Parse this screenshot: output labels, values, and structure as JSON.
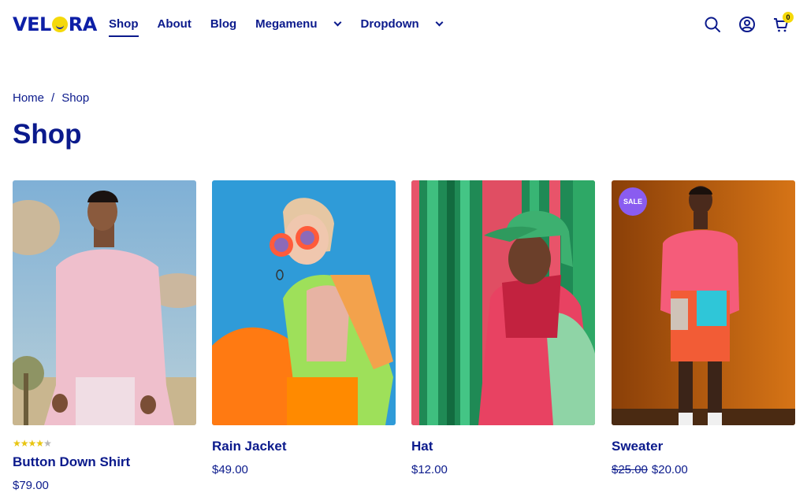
{
  "header": {
    "logo": "VELORA",
    "nav": [
      {
        "label": "Shop",
        "active": true
      },
      {
        "label": "About"
      },
      {
        "label": "Blog"
      },
      {
        "label": "Megamenu"
      },
      {
        "label": "Dropdown"
      }
    ],
    "icons": [
      "search-icon",
      "account-icon",
      "cart-icon"
    ],
    "cart_count": "0"
  },
  "breadcrumb": {
    "home": "Home",
    "separator": "/",
    "current": "Shop"
  },
  "page_title": "Shop",
  "products": [
    {
      "name": "Button Down Shirt",
      "price": "$79.00",
      "rating": 4,
      "rating_max": 5
    },
    {
      "name": "Rain Jacket",
      "price": "$49.00"
    },
    {
      "name": "Hat",
      "price": "$12.00"
    },
    {
      "name": "Sweater",
      "old_price": "$25.00",
      "price": "$20.00",
      "badge": "SALE"
    }
  ],
  "colors": {
    "primary": "#0b1a8c",
    "accent_yellow": "#f5d90a",
    "sale_badge": "#8a5cf0"
  }
}
